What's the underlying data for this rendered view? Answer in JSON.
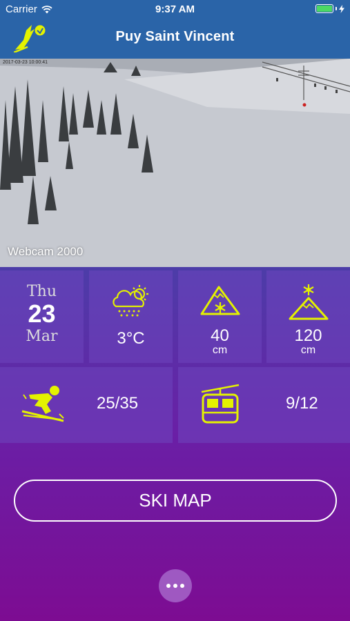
{
  "status_bar": {
    "carrier": "Carrier",
    "time": "9:37 AM"
  },
  "nav": {
    "title": "Puy Saint Vincent",
    "logo_icon": "skier-logo-icon"
  },
  "webcam": {
    "caption": "Webcam 2000",
    "timestamp": "2017-03-23 10:00:41"
  },
  "date": {
    "weekday": "Thu",
    "day": "23",
    "month": "Mar"
  },
  "weather": {
    "icon": "snow-cloud-sun-icon",
    "temperature": "3°C"
  },
  "snow_lower": {
    "icon": "mountain-snowflake-low-icon",
    "value": "40",
    "unit": "cm"
  },
  "snow_upper": {
    "icon": "mountain-snowflake-top-icon",
    "value": "120",
    "unit": "cm"
  },
  "slopes": {
    "icon": "skier-icon",
    "value": "25/35"
  },
  "lifts": {
    "icon": "gondola-icon",
    "value": "9/12"
  },
  "buttons": {
    "ski_map": "SKI MAP",
    "more_icon": "ellipsis-icon"
  },
  "colors": {
    "accent": "#e4f200",
    "nav_bg": "#2a64a8",
    "bg_bottom": "#7d0c92"
  }
}
